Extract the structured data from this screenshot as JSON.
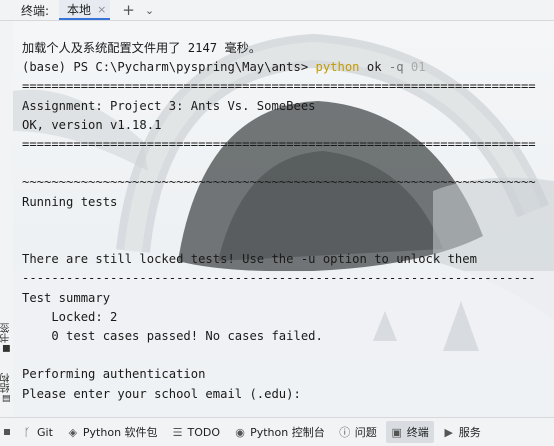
{
  "tab_header": {
    "title": "终端:",
    "active_tab": "本地",
    "close_glyph": "×",
    "add_glyph": "+",
    "menu_glyph": "⌄"
  },
  "terminal": {
    "line1": "加载个人及系统配置文件用了 2147 毫秒。",
    "prompt": "(base) PS C:\\Pycharm\\pyspring\\May\\ants> ",
    "cmd_python": "python",
    "cmd_ok": " ok ",
    "cmd_flag": "-q",
    "cmd_arg": " 01",
    "sep_eq": "======================================================================",
    "assignment": "Assignment: Project 3: Ants Vs. SomeBees",
    "version": "OK, version v1.18.1",
    "sep_tilde": "~~~~~~~~~~~~~~~~~~~~~~~~~~~~~~~~~~~~~~~~~~~~~~~~~~~~~~~~~~~~~~~~~~~~~~",
    "running": "Running tests",
    "locked_msg": "There are still locked tests! Use the -u option to unlock them",
    "sep_dash": "----------------------------------------------------------------------",
    "summary": "Test summary",
    "locked_count": "    Locked: 2",
    "passed": "    0 test cases passed! No cases failed.",
    "auth": "Performing authentication",
    "email_prompt": "Please enter your school email (.edu):"
  },
  "left_strip": {
    "bookmarks": "书签",
    "structure": "结构"
  },
  "bottom_bar": {
    "git": "Git",
    "python_packages": "Python 软件包",
    "todo": "TODO",
    "python_console": "Python 控制台",
    "problems": "问题",
    "terminal": "终端",
    "services": "服务"
  }
}
